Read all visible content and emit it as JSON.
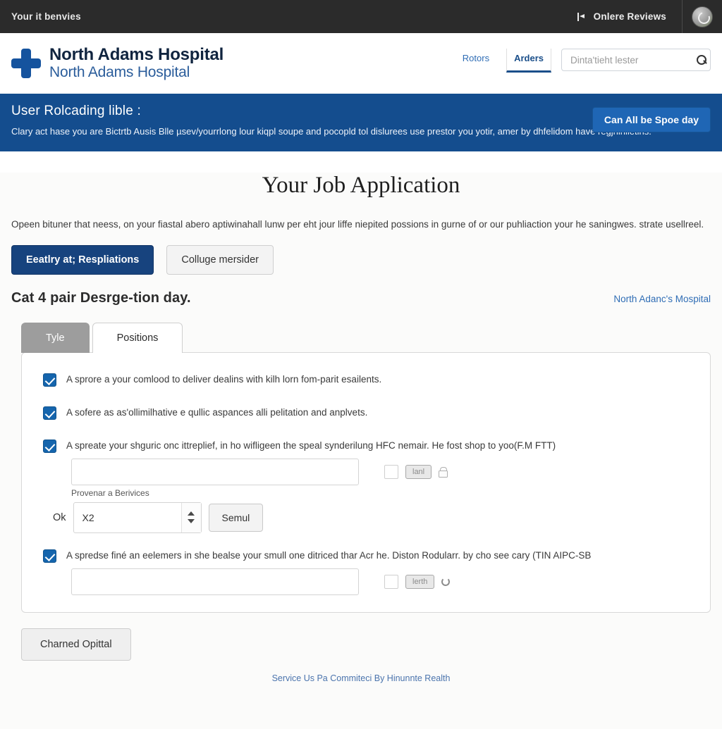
{
  "topbar": {
    "left_label": "Your it benvies",
    "review_label": "Onlere Reviews",
    "back_icon": "back-arrow-icon",
    "avatar_label": "user-avatar"
  },
  "header": {
    "logo_title": "North Adams Hospital",
    "logo_subtitle": "North Adams Hospital",
    "nav": [
      {
        "label": "Rotors",
        "active": false
      },
      {
        "label": "Arders",
        "active": true
      }
    ],
    "search": {
      "placeholder": "Dinta'tieht lester",
      "value": "",
      "icon": "search-icon"
    },
    "cta_label": "Can All be Spoe day"
  },
  "banner": {
    "title": "User Rolcading lible :",
    "body": "Clary act hase you are Bictrtb Ausis Blle µsev/yourrlong lour kiqpl soupe and pocopld tol dislurees use prestor you yotir, amer by dhfelidom have regjninlietlns."
  },
  "main": {
    "page_title": "Your Job Application",
    "intro": "Opeen bituner that neess, on your fiastal abero aptiwinahall lunw per eht jour liffe niepited possions in gurne of or our puhliaction your he saningwes. strate usellreel.",
    "buttons": {
      "primary": "Eeatlry at; Respliations",
      "secondary": "Colluge mersider"
    },
    "section_title": "Cat 4 pair Desrge-tion day.",
    "section_link": "North Adanc's Mospital",
    "tabs": [
      {
        "label": "Tyle",
        "active": false
      },
      {
        "label": "Positions",
        "active": true
      }
    ],
    "items": [
      {
        "checked": true,
        "label": "A sprore a your comlood to deliver dealins with kilh lorn fom-parit esailents."
      },
      {
        "checked": true,
        "label": "A sofere as as'ollimilhative e qullic aspances alli pelitation and anplvets."
      },
      {
        "checked": true,
        "label": "A spreate your shguric onc ittreplief, in ho wifligeen the speal synderilung HFC nemair. He fost shop to yoo(F.M FTT)",
        "input_value": "",
        "mini_checkbox": false,
        "mini_button": "lanl",
        "mini_icon": "lock-icon",
        "sub_label": "Provenar a Berivices"
      },
      {
        "checked": true,
        "label": "A spredse finé an eelemers in she bealse your smull one ditriced thar Acr he. Diston Rodularr. by cho see cary (TIN AIPC-SB",
        "input_value": "",
        "mini_checkbox": false,
        "mini_button": "lerth",
        "mini_icon": "refresh-icon"
      }
    ],
    "spinner_row": {
      "label": "Ok",
      "value": "X2",
      "button_label": "Semul",
      "up_icon": "chevron-up-icon",
      "down_icon": "chevron-down-icon"
    },
    "bottom_button": "Charned Opittal"
  },
  "footer": {
    "text": "Service Us Pa Commiteci By Hinunnte Realth"
  }
}
